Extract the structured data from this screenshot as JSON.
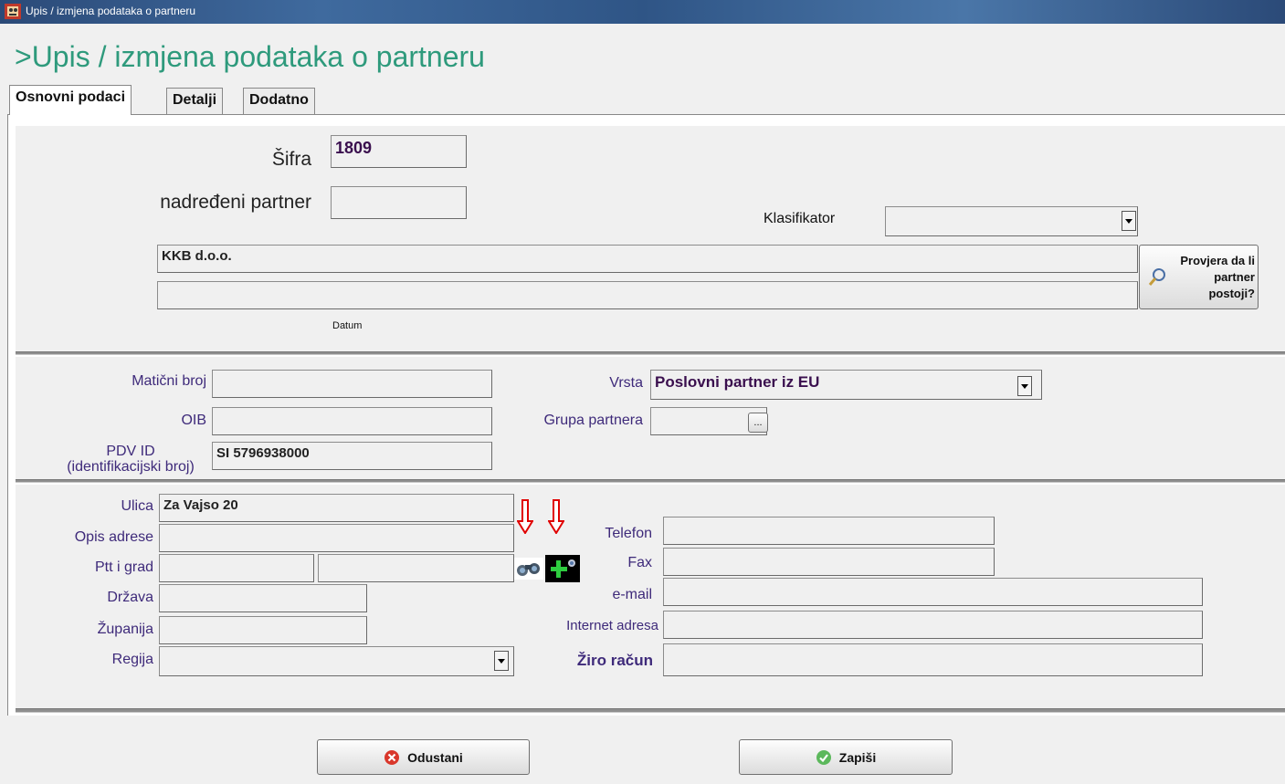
{
  "window": {
    "title": "Upis / izmjena podataka o partneru"
  },
  "header": {
    "title": ">Upis / izmjena podataka o partneru"
  },
  "tabs": [
    {
      "label": "Osnovni podaci",
      "active": true
    },
    {
      "label": "Detalji",
      "active": false
    },
    {
      "label": "Dodatno",
      "active": false
    }
  ],
  "basic": {
    "sifra_label": "Šifra",
    "sifra_value": "1809",
    "parent_label": "nadređeni partner",
    "parent_value": "",
    "klasifikator_label": "Klasifikator",
    "klasifikator_value": "",
    "name_value": "KKB d.o.o.",
    "name2_value": "",
    "check_button_label": "Provjera da li partner postoji?",
    "datum_label": "Datum"
  },
  "identity": {
    "maticni_label": "Matični broj",
    "maticni_value": "",
    "oib_label": "OIB",
    "oib_value": "",
    "pdv_label_1": "PDV ID",
    "pdv_label_2": "(identifikacijski broj)",
    "pdv_value": "SI 5796938000",
    "vrsta_label": "Vrsta",
    "vrsta_value": "Poslovni partner iz EU",
    "grupa_label": "Grupa partnera",
    "grupa_value": "",
    "grupa_button": "..."
  },
  "address": {
    "ulica_label": "Ulica",
    "ulica_value": "Za Vajso 20",
    "opis_label": "Opis adrese",
    "opis_value": "",
    "ptt_label": "Ptt i grad",
    "ptt_value": "",
    "grad_value": "",
    "drzava_label": "Država",
    "drzava_value": "",
    "zupanija_label": "Županija",
    "zupanija_value": "",
    "regija_label": "Regija",
    "regija_value": "",
    "telefon_label": "Telefon",
    "telefon_value": "",
    "fax_label": "Fax",
    "fax_value": "",
    "email_label": "e-mail",
    "email_value": "",
    "internet_label": "Internet adresa",
    "internet_value": "",
    "ziro_label": "Žiro račun",
    "ziro_value": ""
  },
  "buttons": {
    "cancel_label": "Odustani",
    "save_label": "Zapiši"
  },
  "colors": {
    "title_green": "#2e9a7c",
    "label_purple": "#3e2a7a",
    "value_purple": "#3a0f4e",
    "arrow_red": "#e00000",
    "add_green": "#2ecc40"
  }
}
